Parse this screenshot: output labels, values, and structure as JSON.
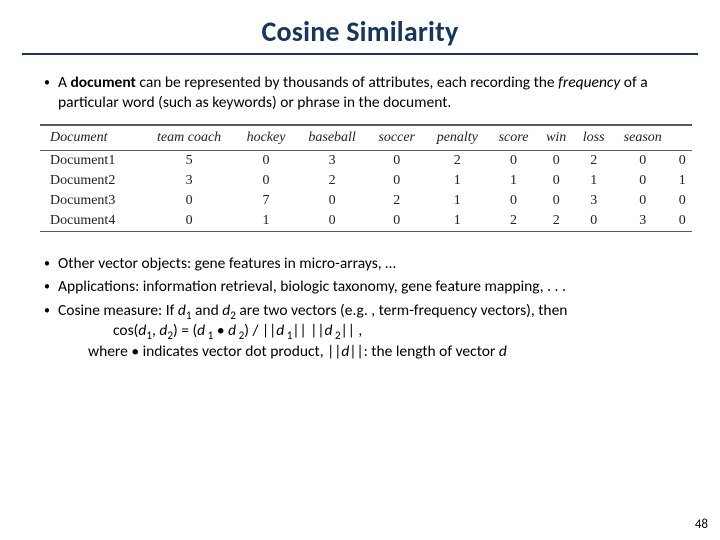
{
  "title": "Cosine Similarity",
  "bullets_top": [
    {
      "prefix": "A ",
      "bold": "document",
      "mid": " can be represented by thousands of attributes, each recording the ",
      "italic": "frequency",
      "suffix": " of a particular word (such as keywords) or phrase in the document."
    }
  ],
  "table": {
    "headers": [
      "Document",
      "team coach",
      "hockey",
      "baseball",
      "soccer",
      "penalty",
      "score",
      "win",
      "loss",
      "season"
    ],
    "rows": [
      [
        "Document1",
        "5",
        "0",
        "3",
        "0",
        "2",
        "0",
        "0",
        "2",
        "0",
        "0"
      ],
      [
        "Document2",
        "3",
        "0",
        "2",
        "0",
        "1",
        "1",
        "0",
        "1",
        "0",
        "1"
      ],
      [
        "Document3",
        "0",
        "7",
        "0",
        "2",
        "1",
        "0",
        "0",
        "3",
        "0",
        "0"
      ],
      [
        "Document4",
        "0",
        "1",
        "0",
        "0",
        "1",
        "2",
        "2",
        "0",
        "3",
        "0"
      ]
    ]
  },
  "bullets_bottom": {
    "b1": "Other vector objects: gene features in micro-arrays, …",
    "b2": "Applications: information retrieval, biologic taxonomy, gene feature mapping, . . .",
    "b3_prefix": "Cosine measure: If ",
    "b3_d1": "d",
    "b3_s1": "1",
    "b3_and": " and ",
    "b3_d2": "d",
    "b3_s2": "2",
    "b3_mid": " are two vectors (e.g. , term-frequency vectors), then",
    "formula_lhs": "cos(",
    "formula_d1": "d",
    "formula_s1": "1",
    "formula_comma": ", ",
    "formula_d2": "d",
    "formula_s2": "2",
    "formula_eq": ") =  (",
    "formula_pd1": "d",
    "formula_ps1": " 1",
    "formula_dot": " • ",
    "formula_pd2": "d",
    "formula_ps2": " 2",
    "formula_div": ") / |",
    "formula_bar1": "|",
    "formula_nd1": "d",
    "formula_ns1": " 1",
    "formula_bar2": "|",
    "formula_mid2": "|  |",
    "formula_bar3": "|",
    "formula_nd2": "d",
    "formula_ns2": " 2",
    "formula_bar4": "|",
    "formula_end": "|  ,",
    "where_prefix": "where • indicates vector dot product, ||",
    "where_d": "d",
    "where_suffix": "||: the length of vector ",
    "where_d2": "d"
  },
  "pagenum": "48",
  "chart_data": {
    "type": "table",
    "title": "Term-frequency vectors for four documents",
    "columns": [
      "team coach",
      "hockey",
      "baseball",
      "soccer",
      "penalty",
      "score",
      "win",
      "loss",
      "season"
    ],
    "series": [
      {
        "name": "Document1",
        "values": [
          5,
          0,
          3,
          0,
          2,
          0,
          0,
          2,
          0,
          0
        ]
      },
      {
        "name": "Document2",
        "values": [
          3,
          0,
          2,
          0,
          1,
          1,
          0,
          1,
          0,
          1
        ]
      },
      {
        "name": "Document3",
        "values": [
          0,
          7,
          0,
          2,
          1,
          0,
          0,
          3,
          0,
          0
        ]
      },
      {
        "name": "Document4",
        "values": [
          0,
          1,
          0,
          0,
          1,
          2,
          2,
          0,
          3,
          0
        ]
      }
    ]
  }
}
